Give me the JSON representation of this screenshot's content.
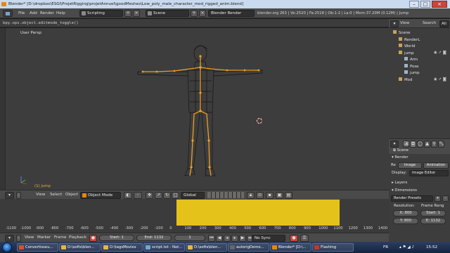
{
  "window": {
    "title": "Blender* [D:\\dropbox\\ESGI\\ProjetRigging\\projetAnnuel\\goodMeshes\\Low_poly_male_character_mod_rigged_anim.blend]"
  },
  "info_header": {
    "menus": [
      "File",
      "Add",
      "Render",
      "Help"
    ],
    "layout": "Scripting",
    "scene": "Scene",
    "engine": "Blender Render",
    "stats": "blender.org 263 | Ve:2520 | Fa:2518 | Ob:1-2 | La:0 | Mem:37.20M (0.12M) | Jump"
  },
  "console": {
    "text": "bpy.ops.object.editmode_toggle()"
  },
  "viewport": {
    "view_label": "User Persp",
    "object_label": "(1) jump"
  },
  "viewport_header": {
    "menus": [
      "View",
      "Select",
      "Object"
    ],
    "mode": "Object Mode",
    "orientation": "Global"
  },
  "timeline": {
    "ruler": [
      "-1100",
      "-1000",
      "-900",
      "-800",
      "-700",
      "-600",
      "-500",
      "-400",
      "-300",
      "-200",
      "-100",
      "0",
      "100",
      "200",
      "300",
      "400",
      "500",
      "600",
      "700",
      "800",
      "900",
      "1000",
      "1100",
      "1200",
      "1300",
      "1400"
    ],
    "range_color": "#e4c21a"
  },
  "timeline_footer": {
    "menus": [
      "View",
      "Marker",
      "Frame",
      "Playback"
    ],
    "start": "Start: 1",
    "end": "End: 1132",
    "current": "1",
    "sync": "No Sync"
  },
  "outliner": {
    "header": {
      "view_label": "View",
      "search_label": "Search",
      "filter": "All"
    },
    "rows": [
      {
        "label": "Scene",
        "depth": 0
      },
      {
        "label": "RenderL",
        "depth": 1
      },
      {
        "label": "World",
        "depth": 1
      },
      {
        "label": "jump",
        "depth": 1
      },
      {
        "label": "Arm",
        "depth": 2
      },
      {
        "label": "Pose",
        "depth": 2
      },
      {
        "label": "jump",
        "depth": 2
      },
      {
        "label": "Mod",
        "depth": 1
      }
    ]
  },
  "properties": {
    "context": "Scene",
    "render_section": "Render",
    "image_button": "Image",
    "animation_button": "Animation",
    "display_label": "Display:",
    "display_value": "Image Editor",
    "layers_section": "Layers",
    "dimensions_section": "Dimensions",
    "render_presets": "Render Presets",
    "resolution_label": "Resolution:",
    "frame_range_label": "Frame Rang",
    "res_x": "X: 800",
    "res_y": "Y: 800",
    "frame_start": "Start: 1",
    "frame_end": "E: 1132"
  },
  "taskbar": {
    "items": [
      {
        "label": "Convertisseu...",
        "color": "#d94f2a"
      },
      {
        "label": "D:\\softs\\blen...",
        "color": "#e8b640"
      },
      {
        "label": "D:\\tagsMovies",
        "color": "#e8b640"
      },
      {
        "label": "script.txt - Not...",
        "color": "#6fa7dc"
      },
      {
        "label": "D:\\softs\\blen...",
        "color": "#e8b640"
      },
      {
        "label": "autorigDemo...",
        "color": "#666666"
      },
      {
        "label": "Blender* [D:\\...",
        "color": "#e8860f"
      },
      {
        "label": "Flashing",
        "color": "#c0392b"
      }
    ],
    "language": "FR",
    "clock": "15:52"
  }
}
